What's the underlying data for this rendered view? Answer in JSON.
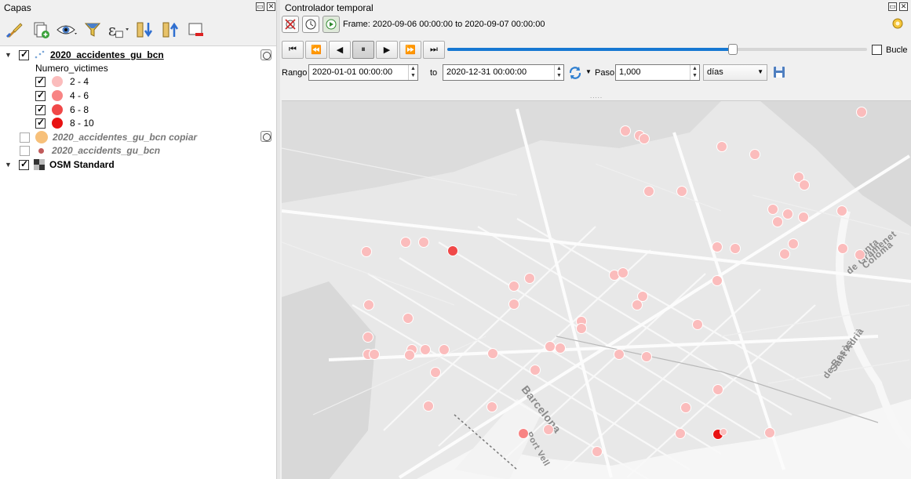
{
  "layers_panel": {
    "title": "Capas",
    "toolbar": [
      "style-brush-icon",
      "add-group-icon",
      "eye-icon",
      "filter-icon",
      "expression-icon",
      "expand-all-icon",
      "collapse-all-icon",
      "remove-layer-icon"
    ],
    "layer1": {
      "name": "2020_accidentes_gu_bcn",
      "checked": true
    },
    "legend_field": "Numero_victimes",
    "classes": [
      {
        "label": "2 - 4",
        "color": "#fbbcbc",
        "checked": true
      },
      {
        "label": "4 - 6",
        "color": "#f88484",
        "checked": true
      },
      {
        "label": "6 - 8",
        "color": "#f04848",
        "checked": true
      },
      {
        "label": "8 - 10",
        "color": "#e81212",
        "checked": true
      }
    ],
    "layer2": {
      "name": "2020_accidentes_gu_bcn copiar",
      "color": "#f7c07a",
      "checked": false
    },
    "layer3": {
      "name": "2020_accidents_gu_bcn",
      "color": "#c05a5a",
      "checked": false
    },
    "layer4": {
      "name": "OSM Standard",
      "checked": true
    }
  },
  "temporal": {
    "title": "Controlador temporal",
    "frame_text": "Frame: 2020-09-06 00:00:00 to 2020-09-07 00:00:00",
    "nav_buttons": [
      "⏮",
      "⏪",
      "◀",
      "⏸",
      "▶",
      "⏩",
      "⏭"
    ],
    "progress": 0.68,
    "loop_label": "Bucle",
    "range_label": "Rango",
    "range_start": "2020-01-01 00:00:00",
    "to_label": "to",
    "range_end": "2020-12-31 00:00:00",
    "step_label": "Paso",
    "step_value": "1,000",
    "unit_value": "días"
  },
  "map": {
    "labels": {
      "santa_coloma": "Santa Coloma",
      "de_gramenet": "de Gramenet",
      "sant_adria": "Sant Adrià",
      "de_besos": "de Besòs",
      "barcelona": "Barcelona",
      "port_vell": "Port Vell"
    }
  }
}
